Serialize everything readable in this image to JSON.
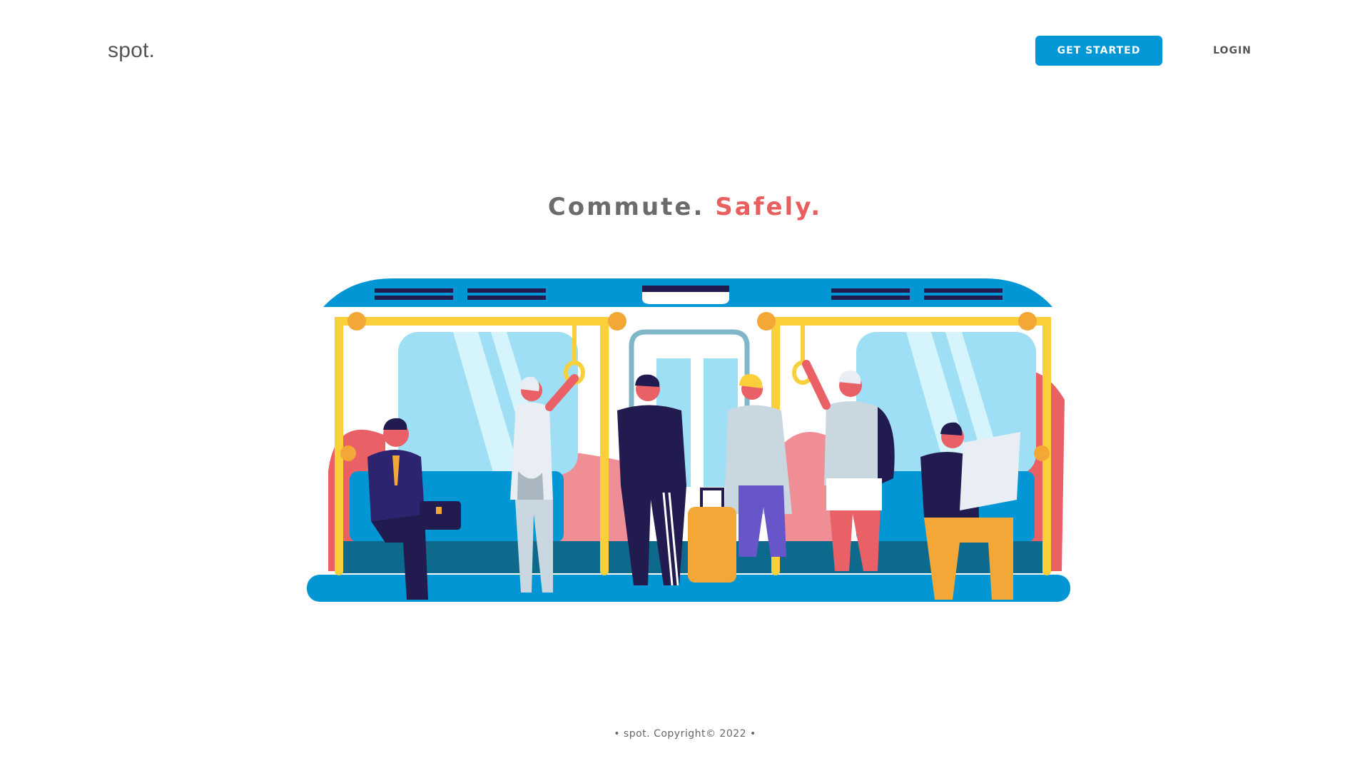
{
  "brand": {
    "logo": "spot."
  },
  "header": {
    "get_started_label": "GET STARTED",
    "login_label": "LOGIN"
  },
  "hero": {
    "headline_part1": "Commute.",
    "headline_part2": "Safely."
  },
  "footer": {
    "text": "• spot. Copyright© 2022 •"
  },
  "colors": {
    "accent": "#0397d6",
    "headline_gray": "#6b6b6b",
    "headline_red": "#e85f5f",
    "train_blue": "#0396d4",
    "rail_yellow": "#f9cf3a",
    "window_light": "#9fdff5",
    "coral": "#e96166",
    "navy": "#221b4f"
  },
  "illustration": {
    "icon": "subway-commuters-illustration"
  }
}
